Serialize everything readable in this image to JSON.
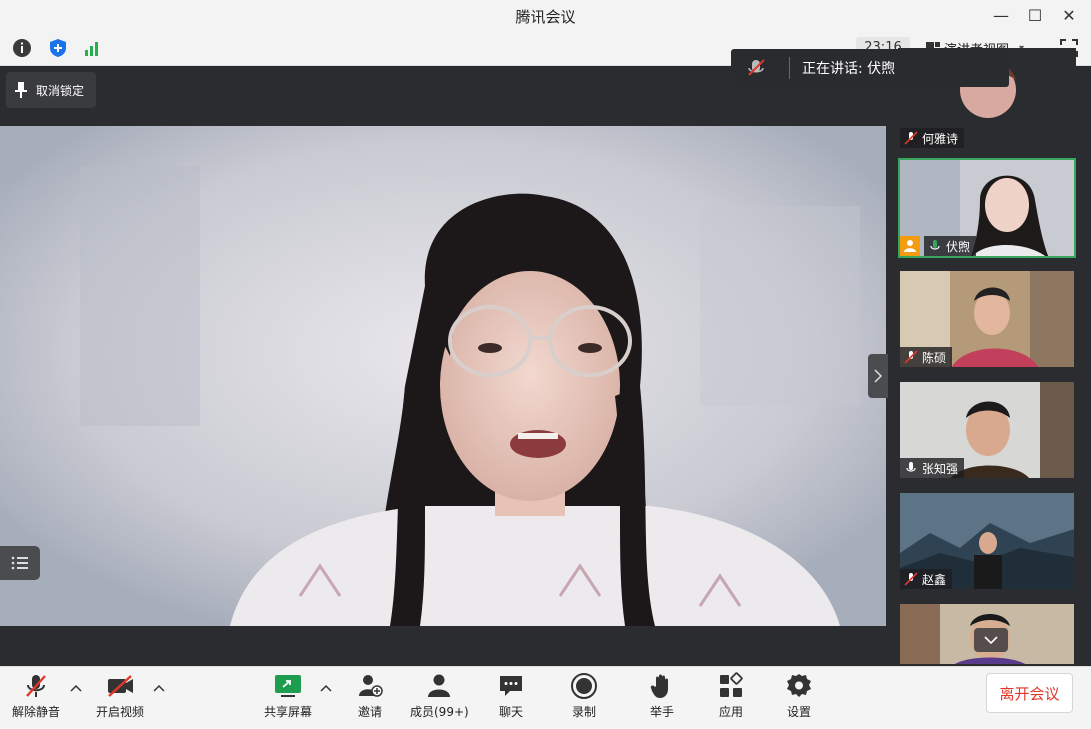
{
  "window": {
    "title": "腾讯会议",
    "minimize": "—",
    "maximize": "☐",
    "close": "✕"
  },
  "toolbar": {
    "time": "23:16",
    "view_label": "演讲者视图",
    "view_caret": "▾"
  },
  "speaking_banner": {
    "text": "正在讲话: 伏煦"
  },
  "main": {
    "pin_label": "取消锁定"
  },
  "participants": [
    {
      "name": "何雅诗",
      "mic": "muted"
    },
    {
      "name": "伏煦",
      "mic": "on",
      "host": true
    },
    {
      "name": "陈硕",
      "mic": "muted"
    },
    {
      "name": "张知强",
      "mic": "on"
    },
    {
      "name": "赵鑫",
      "mic": "muted"
    },
    {
      "name": "",
      "mic": ""
    }
  ],
  "bottombar": {
    "unmute": "解除静音",
    "start_video": "开启视频",
    "share_screen": "共享屏幕",
    "invite": "邀请",
    "members": "成员(99+)",
    "chat": "聊天",
    "record": "录制",
    "raise_hand": "举手",
    "apps": "应用",
    "settings": "设置",
    "leave": "离开会议"
  },
  "colors": {
    "accent_green": "#3aa55d",
    "leave_red": "#e0372b",
    "muted_red": "#e0372b",
    "shield_blue": "#1a73e8",
    "signal_green": "#27ae4f"
  }
}
